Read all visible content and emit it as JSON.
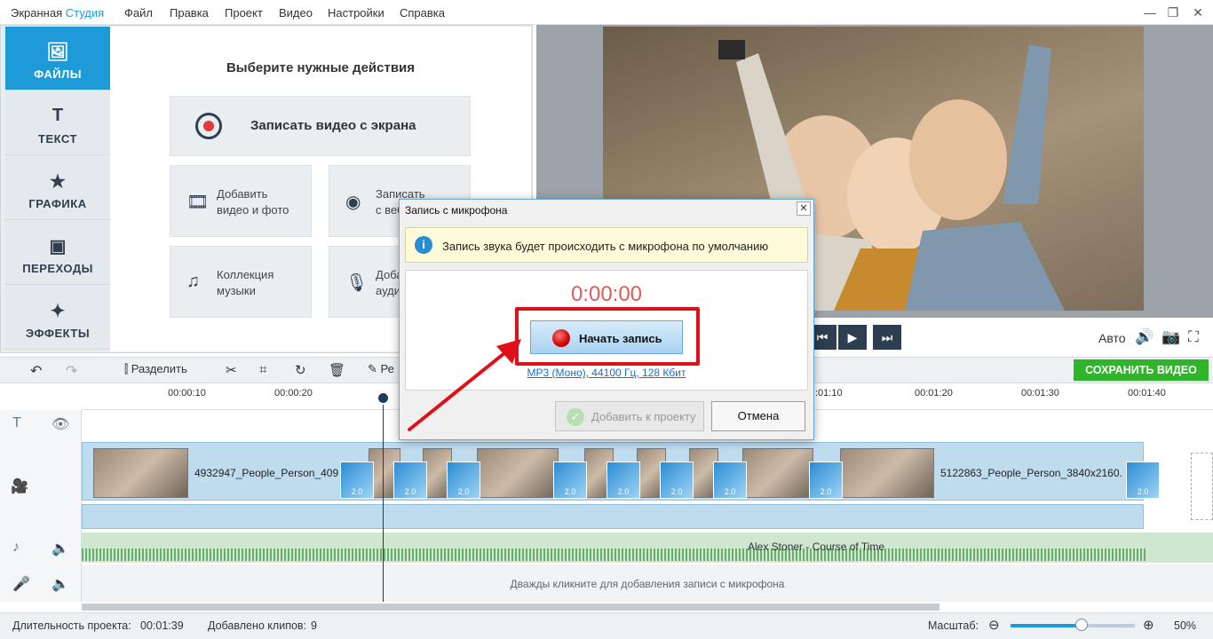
{
  "app": {
    "title_part1": "Экранная ",
    "title_part2": "Студия"
  },
  "menu": [
    "Файл",
    "Правка",
    "Проект",
    "Видео",
    "Настройки",
    "Справка"
  ],
  "window_controls": {
    "minimize": "—",
    "maximize": "❐",
    "close": "✕"
  },
  "sidebar": {
    "items": [
      {
        "label": "ФАЙЛЫ",
        "icon": "🖼"
      },
      {
        "label": "ТЕКСТ",
        "icon": "T"
      },
      {
        "label": "ГРАФИКА",
        "icon": "★"
      },
      {
        "label": "ПЕРЕХОДЫ",
        "icon": "▣"
      },
      {
        "label": "ЭФФЕКТЫ",
        "icon": "✦"
      }
    ]
  },
  "actions": {
    "title": "Выберите нужные действия",
    "record_screen": "Записать видео с экрана",
    "add_video_l1": "Добавить",
    "add_video_l2": "видео и фото",
    "webcam_l1": "Записать",
    "webcam_l2": "с веб",
    "music_l1": "Коллекция",
    "music_l2": "музыки",
    "audio_l1": "Доба",
    "audio_l2": "ауди"
  },
  "player": {
    "auto_label": "Авто"
  },
  "toolbar": {
    "split": "Разделить",
    "re": "Ре",
    "save": "СОХРАНИТЬ ВИДЕО"
  },
  "ruler": [
    "00:00:10",
    "00:00:20",
    ":01:10",
    "00:01:20",
    "00:01:30",
    "00:01:40"
  ],
  "timeline": {
    "clip1": "4932947_People_Person_409",
    "clip2": "5122863_People_Person_3840x2160.",
    "transition_label": "2.0",
    "audio": "Alex Stoner - Course of Time",
    "mic_hint": "Дважды кликните для добавления записи с микрофона"
  },
  "status": {
    "duration_label": "Длительность проекта:",
    "duration_value": "00:01:39",
    "clips_label": "Добавлено клипов:",
    "clips_value": "9",
    "zoom_label": "Масштаб:",
    "zoom_value": "50%",
    "zoom_level": 0.57
  },
  "dialog": {
    "title": "Запись с микрофона",
    "info": "Запись звука будет происходить с микрофона по умолчанию",
    "timer": "0:00:00",
    "record_button": "Начать запись",
    "format": "MP3 (Моно), 44100 Гц, 128 Кбит",
    "add_button": "Добавить к проекту",
    "cancel_button": "Отмена"
  },
  "colors": {
    "accent": "#1d9bd8",
    "save": "#2fb52a",
    "highlight": "#e0101a",
    "timer": "#e15a5a"
  }
}
